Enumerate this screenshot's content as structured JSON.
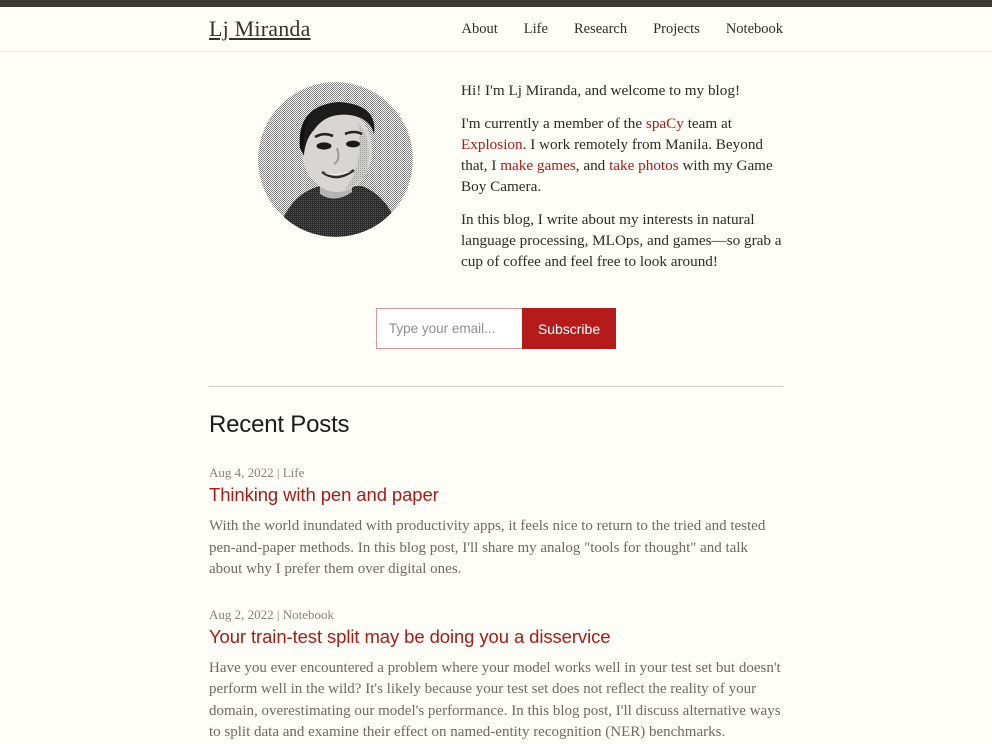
{
  "site": {
    "logo": "Lj Miranda",
    "nav": [
      {
        "label": "About"
      },
      {
        "label": "Life"
      },
      {
        "label": "Research"
      },
      {
        "label": "Projects"
      },
      {
        "label": "Notebook"
      }
    ]
  },
  "intro": {
    "greeting": "Hi! I'm Lj Miranda, and welcome to my blog!",
    "p2": {
      "t1": "I'm currently a member of the ",
      "link1": "spaCy",
      "t2": " team at ",
      "link2": "Explosion",
      "t3": ". I work remotely from Manila. Beyond that, I ",
      "link3": "make games",
      "t4": ", and ",
      "link4": "take photos",
      "t5": " with my Game Boy Camera."
    },
    "p3": "In this blog, I write about my interests in natural language processing, MLOps, and games—so grab a cup of coffee and feel free to look around!",
    "avatar_alt": "portrait-photo"
  },
  "subscribe": {
    "placeholder": "Type your email...",
    "button_label": "Subscribe"
  },
  "recent": {
    "heading": "Recent Posts",
    "posts": [
      {
        "meta": "Aug 4, 2022 | Life",
        "title": "Thinking with pen and paper",
        "excerpt": "With the world inundated with productivity apps, it feels nice to return to the tried and tested pen-and-paper methods. In this blog post, I'll share my analog \"tools for thought\" and talk about why I prefer them over digital ones."
      },
      {
        "meta": "Aug 2, 2022 | Notebook",
        "title": "Your train-test split may be doing you a disservice",
        "excerpt": "Have you ever encountered a problem where your model works well in your test set but doesn't perform well in the wild? It's likely because your test set does not reflect the reality of your domain, overestimating our model's performance. In this blog post, I'll discuss alternative ways to split data and examine their effect on named-entity recognition (NER) benchmarks."
      }
    ]
  },
  "colors": {
    "background": "#fffdf7",
    "accent_red": "#a61c17",
    "button_red": "#b51b1b",
    "topbar": "#3c3a35",
    "muted_text": "#6c6a62"
  }
}
